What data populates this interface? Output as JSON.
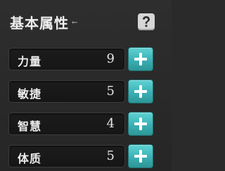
{
  "header": {
    "title": "基本属性",
    "arrow": "←"
  },
  "help_icon": "question-mark-icon",
  "attributes": [
    {
      "label": "力量",
      "value": "9"
    },
    {
      "label": "敏捷",
      "value": "5"
    },
    {
      "label": "智慧",
      "value": "4"
    },
    {
      "label": "体质",
      "value": "5"
    }
  ],
  "colors": {
    "accent": "#3bb0b3",
    "background": "#2a2a2a"
  }
}
